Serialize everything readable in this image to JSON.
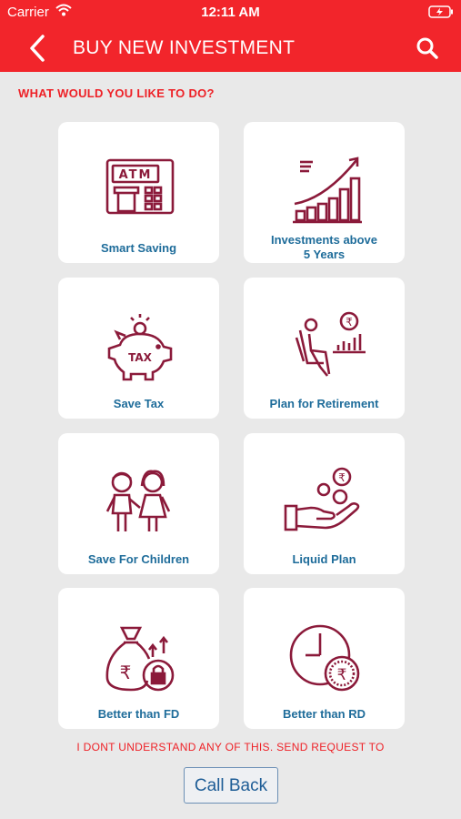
{
  "status_bar": {
    "carrier": "Carrier",
    "time": "12:11 AM"
  },
  "header": {
    "title": "BUY NEW INVESTMENT"
  },
  "prompt": "WHAT WOULD YOU LIKE TO DO?",
  "options": [
    {
      "label": "Smart Saving",
      "icon": "atm-icon"
    },
    {
      "label": "Investments above\n5 Years",
      "icon": "growth-chart-icon"
    },
    {
      "label": "Save Tax",
      "icon": "piggy-bank-tax-icon"
    },
    {
      "label": "Plan for Retirement",
      "icon": "retirement-chair-icon"
    },
    {
      "label": "Save For Children",
      "icon": "children-icon"
    },
    {
      "label": "Liquid Plan",
      "icon": "hand-coins-icon"
    },
    {
      "label": "Better than FD",
      "icon": "money-bag-lock-icon"
    },
    {
      "label": "Better than RD",
      "icon": "clock-rupee-icon"
    }
  ],
  "footer_note": "I DONT UNDERSTAND ANY OF THIS. SEND REQUEST TO",
  "call_back_label": "Call Back",
  "colors": {
    "brand_red": "#f2252b",
    "icon_maroon": "#8b1a3a",
    "label_blue": "#1e6c9a"
  }
}
